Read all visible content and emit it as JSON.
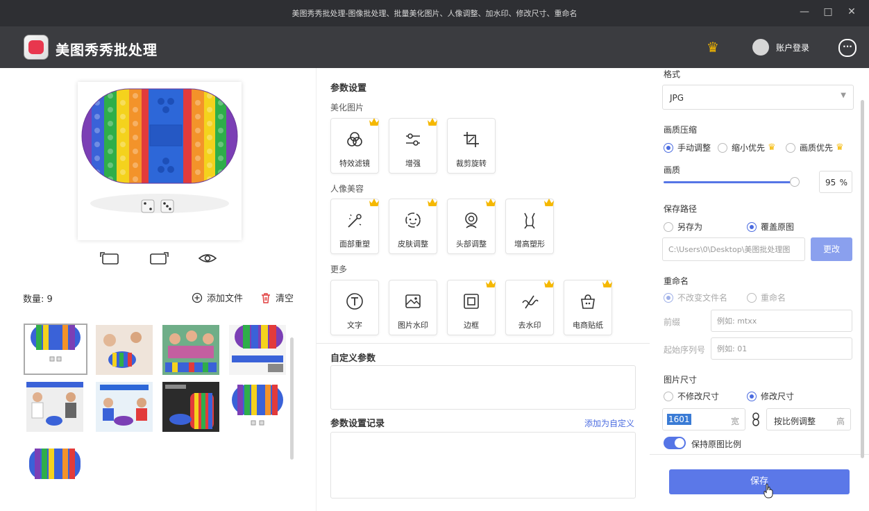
{
  "window": {
    "title": "美图秀秀批处理-图像批处理、批量美化图片、人像调整、加水印、修改尺寸、重命名",
    "minimize": "—",
    "maximize": "□",
    "close": "✕"
  },
  "header": {
    "app_name": "美图秀秀批处理",
    "vip_icon": "crown-icon",
    "login_label": "账户登录",
    "more_icon": "ellipsis-icon"
  },
  "left": {
    "count_label": "数量: 9",
    "add_file_label": "添加文件",
    "clear_label": "清空",
    "preview_tools": [
      "rotate-left-icon",
      "rotate-right-icon",
      "preview-eye-icon"
    ]
  },
  "params": {
    "title": "参数设置",
    "groups": [
      {
        "label": "美化图片",
        "items": [
          {
            "label": "特效滤镜",
            "vip": true
          },
          {
            "label": "增强",
            "vip": true
          },
          {
            "label": "裁剪旋转",
            "vip": false
          }
        ]
      },
      {
        "label": "人像美容",
        "items": [
          {
            "label": "面部重塑",
            "vip": true
          },
          {
            "label": "皮肤调整",
            "vip": true
          },
          {
            "label": "头部调整",
            "vip": true
          },
          {
            "label": "增高塑形",
            "vip": true
          }
        ]
      },
      {
        "label": "更多",
        "items": [
          {
            "label": "文字",
            "vip": false
          },
          {
            "label": "图片水印",
            "vip": false
          },
          {
            "label": "边框",
            "vip": true
          },
          {
            "label": "去水印",
            "vip": true
          },
          {
            "label": "电商贴纸",
            "vip": true
          }
        ]
      }
    ],
    "custom_title": "自定义参数",
    "history_title": "参数设置记录",
    "add_custom_link": "添加为自定义"
  },
  "settings": {
    "format_label": "格式",
    "format_value": "JPG",
    "compress_label": "画质压缩",
    "compress_options": [
      "手动调整",
      "缩小优先",
      "画质优先"
    ],
    "quality_label": "画质",
    "quality_value": "95",
    "quality_unit": "%",
    "quality_fraction": 0.95,
    "save_path_label": "保存路径",
    "save_path_options": [
      "另存为",
      "覆盖原图"
    ],
    "path_value": "C:\\Users\\0\\Desktop\\美图批处理图",
    "change_label": "更改",
    "rename_label": "重命名",
    "rename_options": [
      "不改变文件名",
      "重命名"
    ],
    "prefix_label": "前缀",
    "prefix_placeholder": "例如: mtxx",
    "start_label": "起始序列号",
    "start_placeholder": "例如: 01",
    "size_label": "图片尺寸",
    "size_options": [
      "不修改尺寸",
      "修改尺寸"
    ],
    "width_value": "1601",
    "width_unit": "宽",
    "link_icon": "chain-link-icon",
    "height_value": "按比例调整",
    "height_unit": "高",
    "keep_ratio_label": "保持原图比例",
    "save_label": "保存"
  },
  "colors": {
    "accent": "#5575e6",
    "titlebar": "#2e2f33",
    "appbar": "#3b3c40",
    "vip": "#f5b800"
  }
}
